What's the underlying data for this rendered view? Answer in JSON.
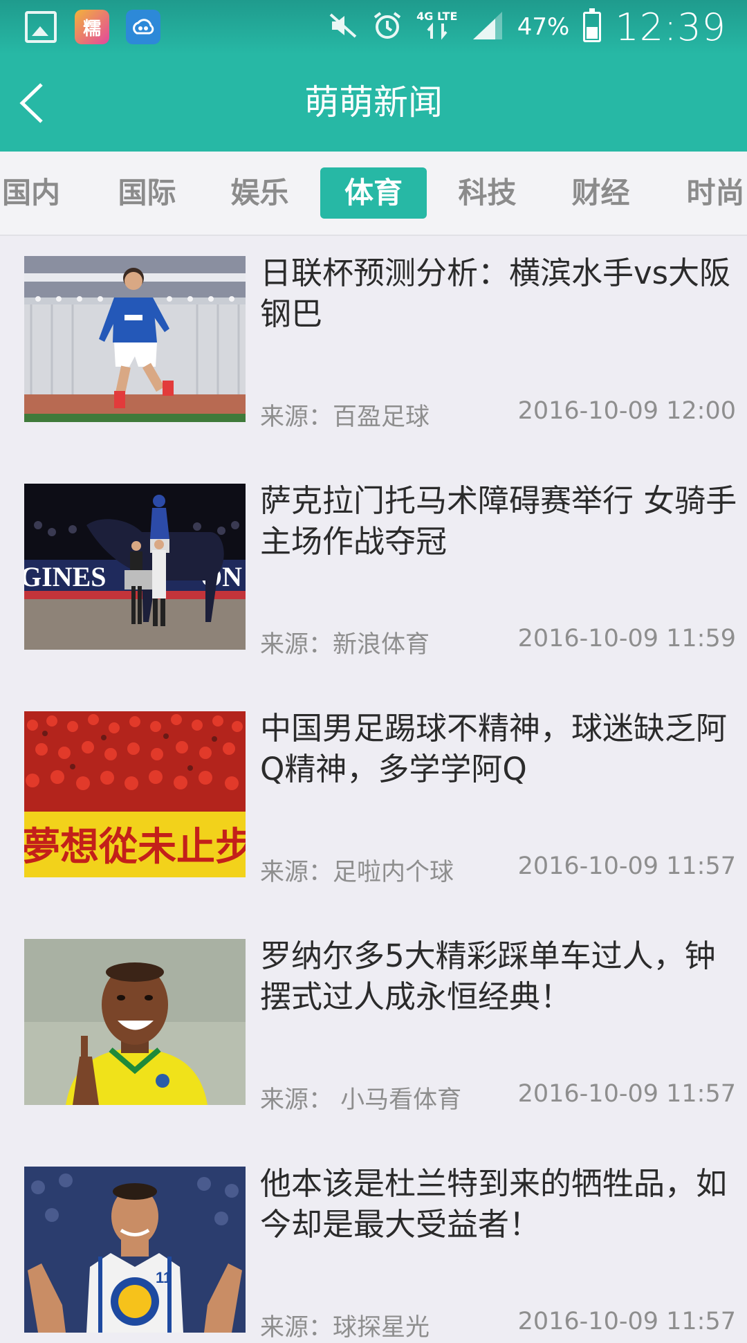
{
  "status_bar": {
    "lte_label": "4G LTE",
    "battery": "47%",
    "time": "12:39",
    "icons": [
      "gallery-icon",
      "nuomi-app-icon",
      "cloud-app-icon",
      "mute-icon",
      "alarm-icon",
      "data-arrows-icon",
      "signal-icon",
      "battery-icon"
    ],
    "nuomi_glyph": "糯"
  },
  "app_bar": {
    "title": "萌萌新闻",
    "back_icon": "chevron-left-icon"
  },
  "tabs": [
    {
      "label": "国内",
      "active": false
    },
    {
      "label": "国际",
      "active": false
    },
    {
      "label": "娱乐",
      "active": false
    },
    {
      "label": "体育",
      "active": true
    },
    {
      "label": "科技",
      "active": false
    },
    {
      "label": "财经",
      "active": false
    },
    {
      "label": "时尚",
      "active": false
    }
  ],
  "colors": {
    "accent": "#27b8a5",
    "background": "#eeedf3",
    "headline": "#2b2b2b",
    "meta": "#8e8e8e"
  },
  "news": [
    {
      "headline": "日联杯预测分析：横滨水手vs大阪钢巴",
      "source": "来源：百盈足球",
      "time": "2016-10-09 12:00",
      "image": "soccer player in blue kit running"
    },
    {
      "headline": "萨克拉门托马术障碍赛举行 女骑手主场作战夺冠",
      "source": "来源：新浪体育",
      "time": "2016-10-09 11:59",
      "image": "equestrian rider on horse in arena"
    },
    {
      "headline": "中国男足踢球不精神，球迷缺乏阿Q精神，多学学阿Q",
      "source": "来源：足啦内个球",
      "time": "2016-10-09 11:57",
      "image": "red-clad fans with yellow banner",
      "banner_text": "夢想從未止步"
    },
    {
      "headline": "罗纳尔多5大精彩踩单车过人，钟摆式过人成永恒经典！",
      "source": "来源： 小马看体育",
      "time": "2016-10-09 11:57",
      "image": "smiling player in yellow jersey"
    },
    {
      "headline": "他本该是杜兰特到来的牺牲品，如今却是最大受益者！",
      "source": "来源：球探星光",
      "time": "2016-10-09 11:57",
      "image": "basketball player in white jersey"
    }
  ]
}
